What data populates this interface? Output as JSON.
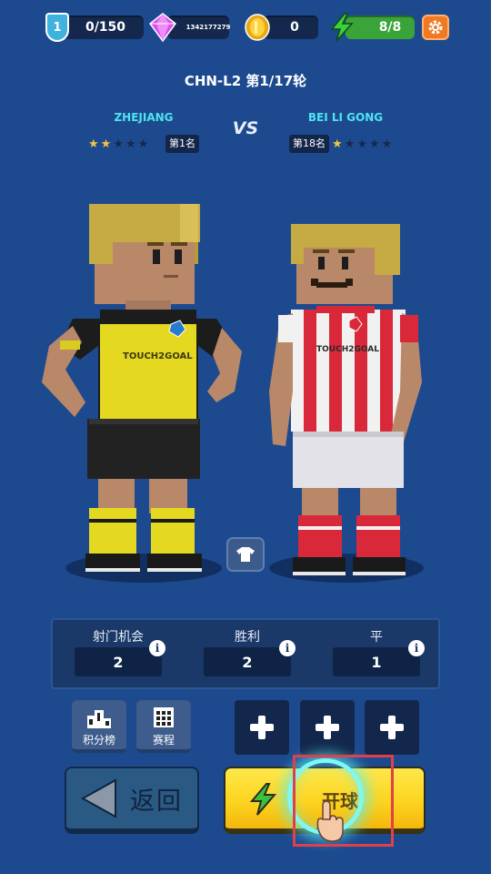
{
  "topbar": {
    "level": "1",
    "xp": "0/150",
    "gems": "1342177279",
    "coins": "0",
    "energy": "8/8",
    "icons": [
      "shield-icon",
      "gem-icon",
      "coin-icon",
      "lightning-icon",
      "gear-icon"
    ]
  },
  "match": {
    "title": "CHN-L2 第1/17轮",
    "vs": "VS",
    "home": {
      "name": "ZHEJIANG",
      "stars": 2,
      "max_stars": 5,
      "rank": "第1名",
      "kit_color": "#e4d820"
    },
    "away": {
      "name": "BEI LI GONG",
      "stars": 1,
      "max_stars": 5,
      "rank": "第18名",
      "kit_color": "#d9283a"
    },
    "kit_text": "TOUCH2GOAL"
  },
  "stats": [
    {
      "label": "射门机会",
      "value": "2"
    },
    {
      "label": "胜利",
      "value": "2"
    },
    {
      "label": "平",
      "value": "1"
    }
  ],
  "buttons": {
    "leaderboard": "积分榜",
    "schedule": "赛程",
    "back": "返回",
    "start": "开球"
  },
  "colors": {
    "background": "#1d4a8f",
    "accent_cyan": "#4fe3f0",
    "start_yellow": "#fcd420",
    "highlight_red": "#e0404a"
  }
}
